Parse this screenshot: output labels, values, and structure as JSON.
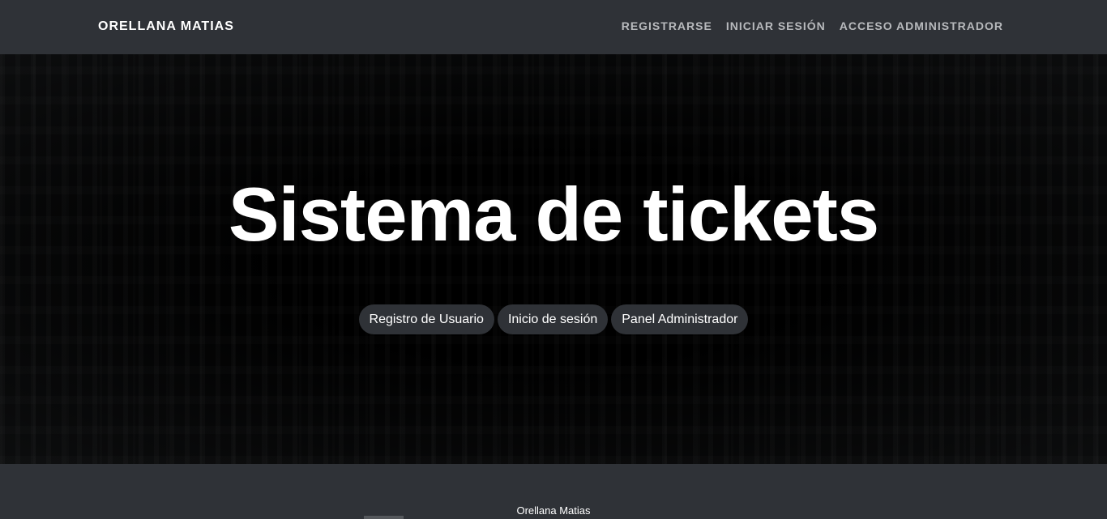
{
  "navbar": {
    "brand": "ORELLANA MATIAS",
    "links": [
      {
        "label": "REGISTRARSE"
      },
      {
        "label": "INICIAR SESIÓN"
      },
      {
        "label": "ACCESO ADMINISTRADOR"
      }
    ]
  },
  "hero": {
    "title": "Sistema de tickets",
    "buttons": [
      {
        "label": "Registro de Usuario"
      },
      {
        "label": "Inicio de sesión"
      },
      {
        "label": "Panel Administrador"
      }
    ]
  },
  "footer": {
    "text": "Orellana Matias"
  },
  "colors": {
    "navbar_bg": "#2f3237",
    "hero_bg": "#050505",
    "pill_bg": "#2f3237",
    "nav_link": "#b8babd"
  }
}
